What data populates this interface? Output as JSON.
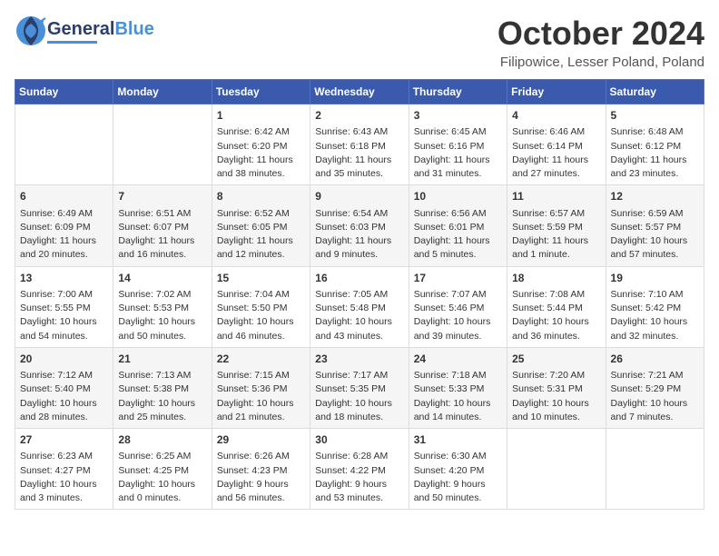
{
  "header": {
    "logo_line1": "General",
    "logo_line2": "Blue",
    "month_title": "October 2024",
    "location": "Filipowice, Lesser Poland, Poland"
  },
  "days_of_week": [
    "Sunday",
    "Monday",
    "Tuesday",
    "Wednesday",
    "Thursday",
    "Friday",
    "Saturday"
  ],
  "weeks": [
    [
      {
        "day": "",
        "content": ""
      },
      {
        "day": "",
        "content": ""
      },
      {
        "day": "1",
        "content": "Sunrise: 6:42 AM\nSunset: 6:20 PM\nDaylight: 11 hours\nand 38 minutes."
      },
      {
        "day": "2",
        "content": "Sunrise: 6:43 AM\nSunset: 6:18 PM\nDaylight: 11 hours\nand 35 minutes."
      },
      {
        "day": "3",
        "content": "Sunrise: 6:45 AM\nSunset: 6:16 PM\nDaylight: 11 hours\nand 31 minutes."
      },
      {
        "day": "4",
        "content": "Sunrise: 6:46 AM\nSunset: 6:14 PM\nDaylight: 11 hours\nand 27 minutes."
      },
      {
        "day": "5",
        "content": "Sunrise: 6:48 AM\nSunset: 6:12 PM\nDaylight: 11 hours\nand 23 minutes."
      }
    ],
    [
      {
        "day": "6",
        "content": "Sunrise: 6:49 AM\nSunset: 6:09 PM\nDaylight: 11 hours\nand 20 minutes."
      },
      {
        "day": "7",
        "content": "Sunrise: 6:51 AM\nSunset: 6:07 PM\nDaylight: 11 hours\nand 16 minutes."
      },
      {
        "day": "8",
        "content": "Sunrise: 6:52 AM\nSunset: 6:05 PM\nDaylight: 11 hours\nand 12 minutes."
      },
      {
        "day": "9",
        "content": "Sunrise: 6:54 AM\nSunset: 6:03 PM\nDaylight: 11 hours\nand 9 minutes."
      },
      {
        "day": "10",
        "content": "Sunrise: 6:56 AM\nSunset: 6:01 PM\nDaylight: 11 hours\nand 5 minutes."
      },
      {
        "day": "11",
        "content": "Sunrise: 6:57 AM\nSunset: 5:59 PM\nDaylight: 11 hours\nand 1 minute."
      },
      {
        "day": "12",
        "content": "Sunrise: 6:59 AM\nSunset: 5:57 PM\nDaylight: 10 hours\nand 57 minutes."
      }
    ],
    [
      {
        "day": "13",
        "content": "Sunrise: 7:00 AM\nSunset: 5:55 PM\nDaylight: 10 hours\nand 54 minutes."
      },
      {
        "day": "14",
        "content": "Sunrise: 7:02 AM\nSunset: 5:53 PM\nDaylight: 10 hours\nand 50 minutes."
      },
      {
        "day": "15",
        "content": "Sunrise: 7:04 AM\nSunset: 5:50 PM\nDaylight: 10 hours\nand 46 minutes."
      },
      {
        "day": "16",
        "content": "Sunrise: 7:05 AM\nSunset: 5:48 PM\nDaylight: 10 hours\nand 43 minutes."
      },
      {
        "day": "17",
        "content": "Sunrise: 7:07 AM\nSunset: 5:46 PM\nDaylight: 10 hours\nand 39 minutes."
      },
      {
        "day": "18",
        "content": "Sunrise: 7:08 AM\nSunset: 5:44 PM\nDaylight: 10 hours\nand 36 minutes."
      },
      {
        "day": "19",
        "content": "Sunrise: 7:10 AM\nSunset: 5:42 PM\nDaylight: 10 hours\nand 32 minutes."
      }
    ],
    [
      {
        "day": "20",
        "content": "Sunrise: 7:12 AM\nSunset: 5:40 PM\nDaylight: 10 hours\nand 28 minutes."
      },
      {
        "day": "21",
        "content": "Sunrise: 7:13 AM\nSunset: 5:38 PM\nDaylight: 10 hours\nand 25 minutes."
      },
      {
        "day": "22",
        "content": "Sunrise: 7:15 AM\nSunset: 5:36 PM\nDaylight: 10 hours\nand 21 minutes."
      },
      {
        "day": "23",
        "content": "Sunrise: 7:17 AM\nSunset: 5:35 PM\nDaylight: 10 hours\nand 18 minutes."
      },
      {
        "day": "24",
        "content": "Sunrise: 7:18 AM\nSunset: 5:33 PM\nDaylight: 10 hours\nand 14 minutes."
      },
      {
        "day": "25",
        "content": "Sunrise: 7:20 AM\nSunset: 5:31 PM\nDaylight: 10 hours\nand 10 minutes."
      },
      {
        "day": "26",
        "content": "Sunrise: 7:21 AM\nSunset: 5:29 PM\nDaylight: 10 hours\nand 7 minutes."
      }
    ],
    [
      {
        "day": "27",
        "content": "Sunrise: 6:23 AM\nSunset: 4:27 PM\nDaylight: 10 hours\nand 3 minutes."
      },
      {
        "day": "28",
        "content": "Sunrise: 6:25 AM\nSunset: 4:25 PM\nDaylight: 10 hours\nand 0 minutes."
      },
      {
        "day": "29",
        "content": "Sunrise: 6:26 AM\nSunset: 4:23 PM\nDaylight: 9 hours\nand 56 minutes."
      },
      {
        "day": "30",
        "content": "Sunrise: 6:28 AM\nSunset: 4:22 PM\nDaylight: 9 hours\nand 53 minutes."
      },
      {
        "day": "31",
        "content": "Sunrise: 6:30 AM\nSunset: 4:20 PM\nDaylight: 9 hours\nand 50 minutes."
      },
      {
        "day": "",
        "content": ""
      },
      {
        "day": "",
        "content": ""
      }
    ]
  ]
}
